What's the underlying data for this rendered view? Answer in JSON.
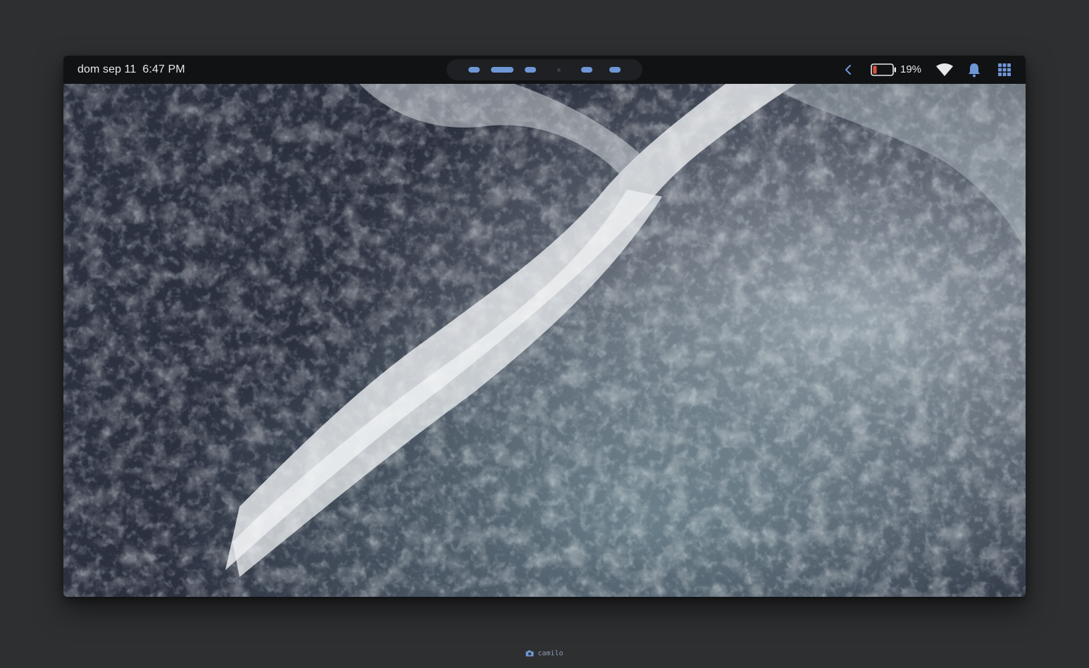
{
  "topbar": {
    "date": "dom sep 11",
    "time": "6:47 PM",
    "workspaces": [
      {
        "state": "occupied"
      },
      {
        "state": "active"
      },
      {
        "state": "occupied"
      },
      {
        "state": "empty"
      },
      {
        "state": "occupied"
      },
      {
        "state": "occupied"
      }
    ],
    "battery_percent": "19%",
    "battery_level": 0.19,
    "icons": {
      "tray_toggle": "chevron-left-icon",
      "battery": "battery-icon",
      "network": "wifi-icon",
      "notifications": "bell-icon",
      "launcher": "app-grid-icon"
    }
  },
  "colors": {
    "accent": "#6f97d6",
    "bar_background": "#111214",
    "battery_low": "#e0503f",
    "outer_background": "#2e2f31"
  },
  "wallpaper": {
    "subject": "aerial ocean waves"
  },
  "caption": {
    "icon": "camera-icon",
    "text": "camilo"
  }
}
